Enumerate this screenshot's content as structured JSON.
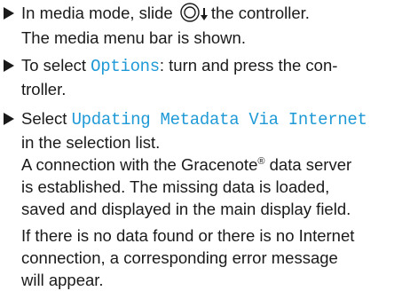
{
  "steps": [
    {
      "lines": [
        {
          "a": "In media mode, slide ",
          "b": "the controller."
        },
        {
          "text": "The media menu bar is shown."
        }
      ]
    },
    {
      "lines": [
        {
          "a": "To select ",
          "code": "Options",
          "b": ": turn and press the con-"
        },
        {
          "text": "troller."
        }
      ]
    },
    {
      "lines": [
        {
          "a": "Select ",
          "code": "Updating Metadata Via Internet"
        },
        {
          "text": "in the selection list."
        },
        {
          "a": "A connection with the Gracenote",
          "sup": "®",
          "b": " data server"
        },
        {
          "text": "is established. The missing data is loaded,"
        },
        {
          "text": "saved and displayed in the main display field."
        },
        {
          "text": "If there is no data found or there is no Internet"
        },
        {
          "text": "connection, a corresponding error message"
        },
        {
          "text": "will appear."
        }
      ]
    }
  ],
  "colors": {
    "text": "#1a1a1a",
    "highlight": "#1f9ad6"
  },
  "icons": [
    "controller-icon",
    "slide-down-arrow-icon",
    "bullet-arrow-icon"
  ]
}
